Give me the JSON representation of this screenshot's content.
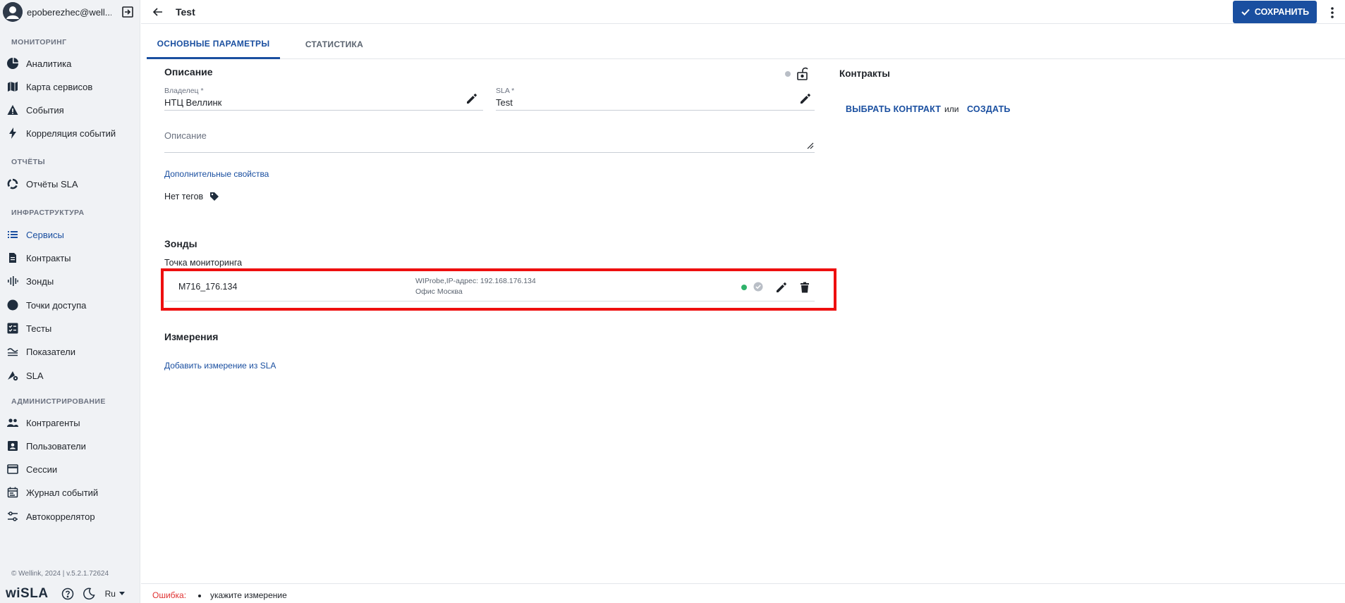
{
  "user": {
    "name": "epoberezhec@well..."
  },
  "sidebar": {
    "sections": [
      {
        "title": "МОНИТОРИНГ"
      },
      {
        "title": "ОТЧЁТЫ"
      },
      {
        "title": "ИНФРАСТРУКТУРА"
      },
      {
        "title": "АДМИНИСТРИРОВАНИЕ"
      }
    ],
    "items": [
      {
        "label": "Аналитика",
        "icon": "pie-chart-icon"
      },
      {
        "label": "Карта сервисов",
        "icon": "map-icon"
      },
      {
        "label": "События",
        "icon": "warning-icon"
      },
      {
        "label": "Корреляция событий",
        "icon": "bolt-icon"
      },
      {
        "label": "Отчёты SLA",
        "icon": "donut-icon"
      },
      {
        "label": "Сервисы",
        "icon": "list-icon",
        "active": true
      },
      {
        "label": "Контракты",
        "icon": "document-icon"
      },
      {
        "label": "Зонды",
        "icon": "waveform-icon"
      },
      {
        "label": "Точки доступа",
        "icon": "globe-icon"
      },
      {
        "label": "Тесты",
        "icon": "checklist-icon"
      },
      {
        "label": "Показатели",
        "icon": "waves-icon"
      },
      {
        "label": "SLA",
        "icon": "sla-gear-icon"
      },
      {
        "label": "Контрагенты",
        "icon": "people-icon"
      },
      {
        "label": "Пользователи",
        "icon": "user-card-icon"
      },
      {
        "label": "Сессии",
        "icon": "window-icon"
      },
      {
        "label": "Журнал событий",
        "icon": "calendar-icon"
      },
      {
        "label": "Автокоррелятор",
        "icon": "sliders-icon"
      }
    ],
    "footer": {
      "copyright": "© Wellink, 2024 | v.5.2.1.72624",
      "logo": "wiSLA",
      "language": "Ru"
    }
  },
  "header": {
    "title": "Test",
    "save_label": "СОХРАНИТЬ"
  },
  "tabs": [
    {
      "label": "ОСНОВНЫЕ ПАРАМЕТРЫ",
      "active": true
    },
    {
      "label": "СТАТИСТИКА",
      "active": false
    }
  ],
  "description_section": {
    "title": "Описание",
    "owner_label": "Владелец *",
    "owner_value": "НТЦ Веллинк",
    "sla_label": "SLA *",
    "sla_value": "Test",
    "description_placeholder": "Описание",
    "extra_props_link": "Дополнительные свойства",
    "no_tags": "Нет тегов"
  },
  "probes_section": {
    "title": "Зонды",
    "subtitle": "Точка мониторинга",
    "probe": {
      "name": "M716_176.134",
      "info_line1": "WIProbe,IP-адрес: 192.168.176.134",
      "info_line2": "Офис Москва"
    }
  },
  "measurements_section": {
    "title": "Измерения",
    "add_link": "Добавить измерение из SLA"
  },
  "contracts_section": {
    "title": "Контракты",
    "select_label": "ВЫБРАТЬ КОНТРАКТ",
    "or_label": "или",
    "create_label": "СОЗДАТЬ"
  },
  "error_bar": {
    "label": "Ошибка:",
    "message": "укажите измерение"
  },
  "colors": {
    "accent": "#1a4fa0",
    "error": "#e03131",
    "highlight": "#ee0f0f",
    "status_ok": "#2fb26a"
  }
}
